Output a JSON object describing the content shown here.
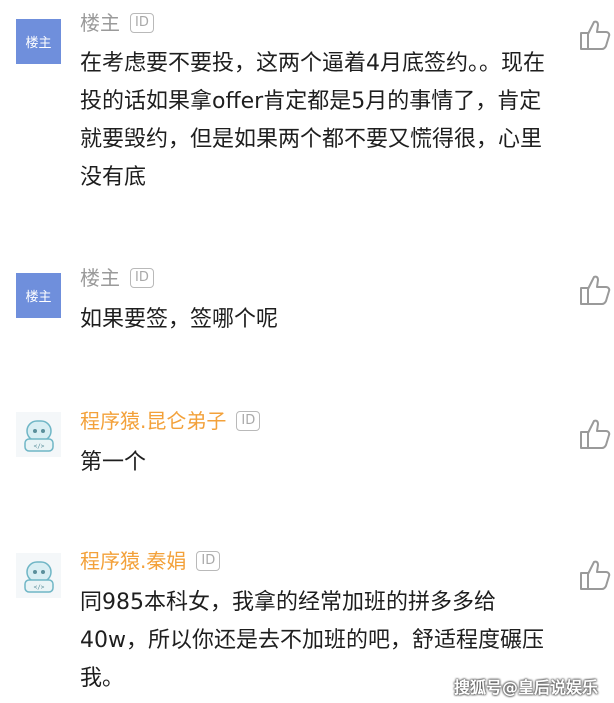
{
  "comments": [
    {
      "author": "楼主",
      "avatar_label": "楼主",
      "id_badge": "ID",
      "text": "在考虑要不要投，这两个逼着4月底签约。。现在投的话如果拿offer肯定都是5月的事情了，肯定就要毁约，但是如果两个都不要又慌得很，心里没有底"
    },
    {
      "author": "楼主",
      "avatar_label": "楼主",
      "id_badge": "ID",
      "text": "如果要签，签哪个呢"
    },
    {
      "author": "程序猿.昆仑弟子",
      "id_badge": "ID",
      "text": "第一个"
    },
    {
      "author": "程序猿.秦娟",
      "id_badge": "ID",
      "text": "同985本科女，我拿的经常加班的拼多多给40w，所以你还是去不加班的吧，舒适程度碾压我。"
    }
  ],
  "watermark": "搜狐号@皇后说娱乐",
  "colors": {
    "owner_avatar": "#6f8fdc",
    "owner_name": "#9a9a9a",
    "member_name": "#f3a13a",
    "text": "#1e1e1e"
  },
  "icons": {
    "like": "thumbs-up-icon",
    "robot_avatar": "robot-avatar-icon"
  }
}
